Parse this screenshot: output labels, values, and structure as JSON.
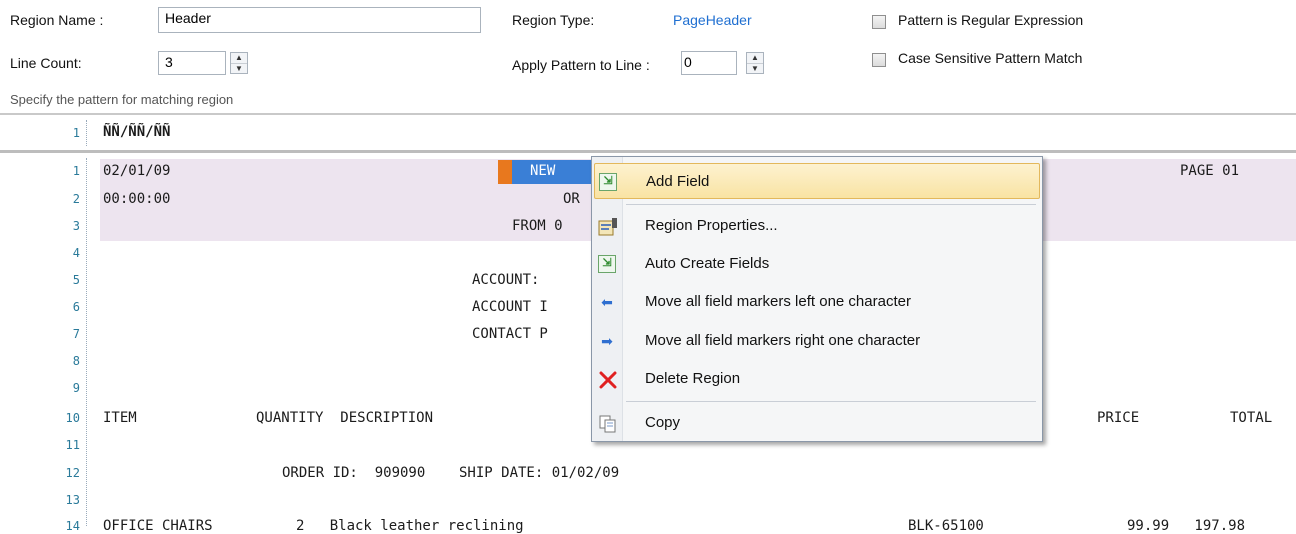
{
  "form": {
    "region_name_label": "Region Name :",
    "region_name_value": "Header",
    "line_count_label": "Line Count:",
    "line_count_value": "3",
    "region_type_label": "Region Type:",
    "region_type_value": "PageHeader",
    "apply_pattern_label": "Apply Pattern to Line :",
    "apply_pattern_value": "0",
    "pattern_regex_label": "Pattern is Regular Expression",
    "pattern_regex_checked": false,
    "case_sensitive_label": "Case Sensitive Pattern Match",
    "case_sensitive_checked": false,
    "hint": "Specify the pattern for matching region"
  },
  "pattern_editor": {
    "line_number": "1",
    "pattern": "ÑÑ/ÑÑ/ÑÑ"
  },
  "report": {
    "line_numbers": [
      "1",
      "2",
      "3",
      "4",
      "5",
      "6",
      "7",
      "8",
      "9",
      "10",
      "11",
      "12",
      "13",
      "14"
    ],
    "lines": [
      {
        "a": "02/01/09",
        "b": "NEW",
        "c": "PAGE 01"
      },
      {
        "a": "00:00:00",
        "b": "OR"
      },
      {
        "b": "FROM 0"
      },
      {},
      {
        "b": "ACCOUNT: "
      },
      {
        "b": "ACCOUNT I"
      },
      {
        "b": "CONTACT P"
      },
      {},
      {},
      {
        "a": "ITEM",
        "b": "QUANTITY  DESCRIPTION",
        "c": "PRICE",
        "d": "TOTAL"
      },
      {},
      {
        "b": "ORDER ID:  909090    SHIP DATE: 01/02/09"
      },
      {},
      {
        "a": "OFFICE CHAIRS",
        "b": "2   Black leather reclining",
        "c": "BLK-65100",
        "d": "99.99   197.98"
      }
    ],
    "highlight_color": "#ede4ef"
  },
  "context_menu": {
    "items": [
      {
        "label": "Add Field",
        "icon": "add-field-icon"
      },
      {
        "label": "Region Properties...",
        "icon": "region-properties-icon"
      },
      {
        "label": "Auto Create Fields",
        "icon": "auto-create-fields-icon"
      },
      {
        "label": "Move all field markers left one character",
        "icon": "arrow-left-icon"
      },
      {
        "label": "Move all field markers right one character",
        "icon": "arrow-right-icon"
      },
      {
        "label": "Delete Region",
        "icon": "delete-icon"
      },
      {
        "label": "Copy",
        "icon": "copy-icon"
      }
    ]
  },
  "colors": {
    "link_blue": "#1f6fd1",
    "gutter_teal": "#2a7a9a",
    "menu_highlight": "#f9e3a3",
    "field_marker_orange": "#e8781e",
    "field_marker_blue": "#3a7fd6"
  }
}
